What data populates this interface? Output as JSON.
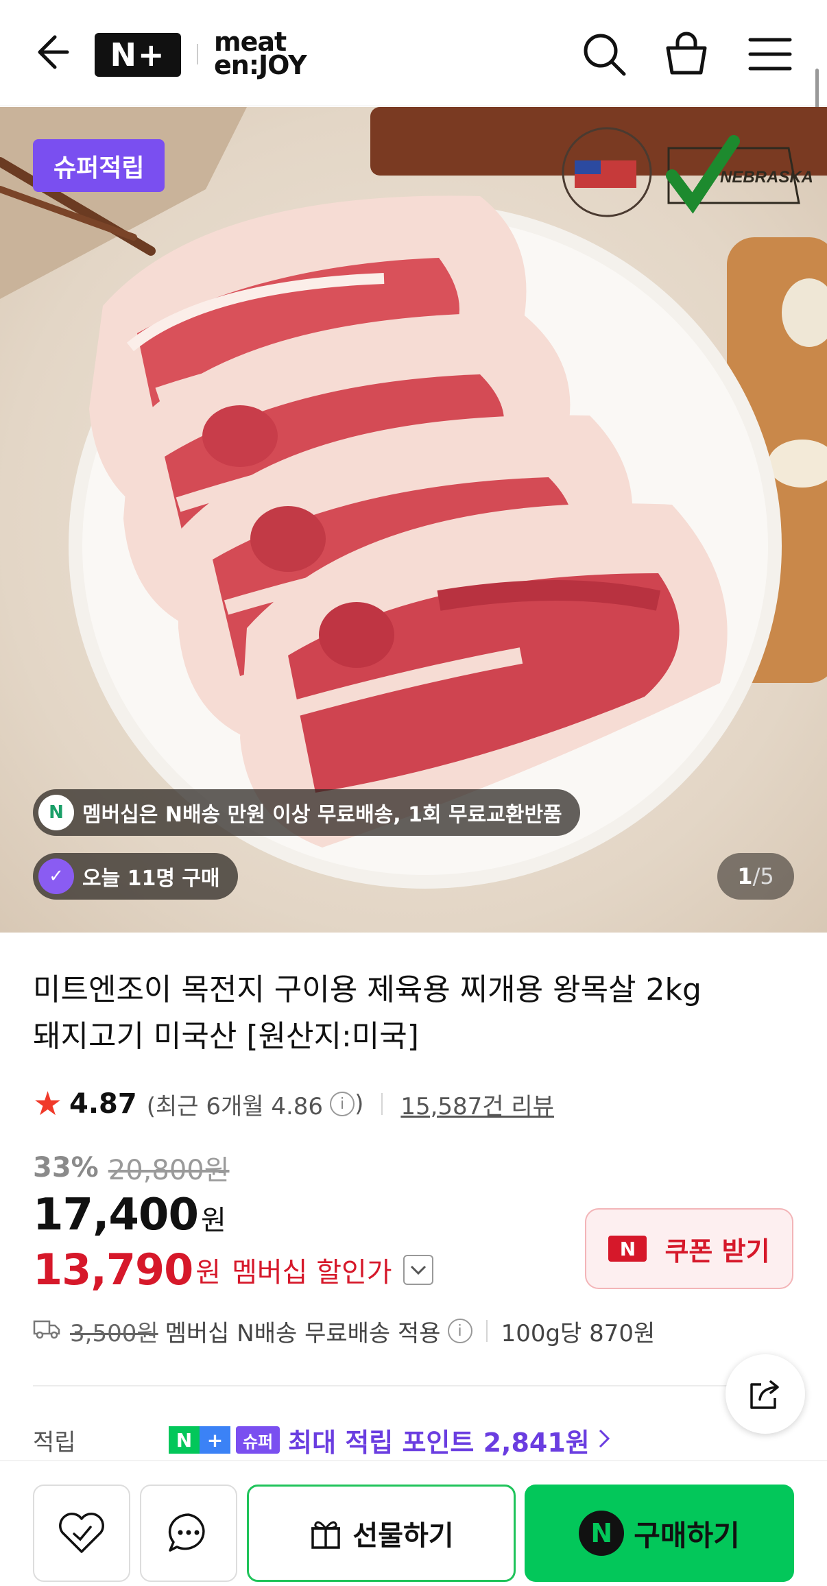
{
  "header": {
    "np_logo": "N+",
    "brand_logo_line1": "meat",
    "brand_logo_line2": "en:JOY"
  },
  "hero": {
    "super_badge": "슈퍼적립",
    "cert_logo_1": "U.S.MEAT EXPORT FEDERATION",
    "cert_logo_2": "NEBRASKA SOYBEAN BOARD",
    "membership_notice": "멤버십은 N배송 만원 이상 무료배송, 1회 무료교환반품",
    "today_buyers": "오늘 11명 구매",
    "image_index": "1",
    "image_total": "/5"
  },
  "product": {
    "title_line1": "미트엔조이 목전지 구이용 제육용 찌개용 왕목살 2kg",
    "title_line2": "돼지고기 미국산 [원산지:미국]",
    "rating": "4.87",
    "rating_recent": "(최근 6개월 4.86",
    "rating_recent_close": ")",
    "review_count": "15,587건 리뷰",
    "discount_pct": "33%",
    "original_price": "20,800원",
    "price": "17,400",
    "price_unit": "원",
    "member_price": "13,790",
    "member_unit": "원",
    "member_label": "멤버십 할인가",
    "coupon_label": "쿠폰 받기",
    "shipping_old": "3,500원",
    "shipping_text": "멤버십 N배송 무료배송 적용",
    "unit_price": "100g당 870원",
    "points_label": "적립",
    "points_super": "슈퍼",
    "points_text": "최대 적립 포인트 2,841원"
  },
  "bottom": {
    "gift_label": "선물하기",
    "buy_label": "구매하기",
    "n_mark": "N"
  },
  "colors": {
    "brand_green": "#03c75a",
    "super_purple": "#7a4ff0",
    "sale_red": "#d6182a"
  }
}
